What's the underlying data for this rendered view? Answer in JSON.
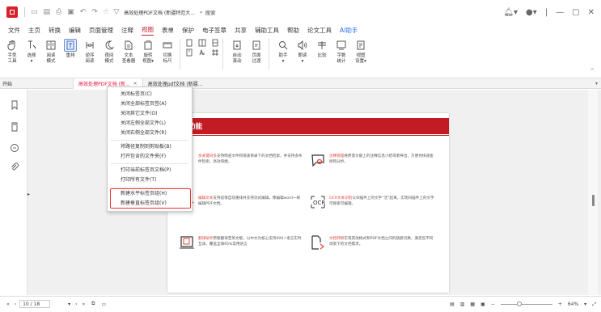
{
  "titlebar": {
    "doc_title": "高效处理PDF文档 (新疆特范大...",
    "search_label": "搜索"
  },
  "menu": [
    "文件",
    "主页",
    "转换",
    "编辑",
    "页面管理",
    "注释",
    "视图",
    "表单",
    "保护",
    "电子签章",
    "共享",
    "辅助工具",
    "帮助",
    "论文工具",
    "AI助手"
  ],
  "menu_active": "视图",
  "toolbar": [
    {
      "label": "手型\n工具",
      "icon": "hand-icon"
    },
    {
      "label": "选择\n▾",
      "icon": "select-cursor-icon"
    },
    {
      "label": "阅读\n模式",
      "icon": "read-mode-icon"
    },
    {
      "label": "重排",
      "icon": "reflow-icon"
    },
    {
      "label": "逆序\n阅读",
      "icon": "reverse-read-icon"
    },
    {
      "label": "夜间\n模式",
      "icon": "night-mode-icon"
    },
    {
      "label": "文本\n查看器",
      "icon": "text-viewer-icon"
    },
    {
      "label": "旋转\n视图▾",
      "icon": "rotate-view-icon"
    },
    {
      "label": "切换\n标尺",
      "icon": "ruler-icon"
    },
    {
      "label": "自动\n滚动",
      "icon": "auto-scroll-icon"
    },
    {
      "label": "页面\n过渡",
      "icon": "page-transition-icon"
    },
    {
      "label": "助手\n▾",
      "icon": "assistant-icon"
    },
    {
      "label": "朗读\n▾",
      "icon": "read-aloud-icon"
    },
    {
      "label": "比较",
      "icon": "compare-icon"
    },
    {
      "label": "字数\n统计",
      "icon": "word-count-icon"
    },
    {
      "label": "视图\n设置▾",
      "icon": "view-settings-icon"
    }
  ],
  "tabs": {
    "start": "开始",
    "current": "高效处理PDF文档 (新...",
    "other": "高效处理pdf文档 (新疆..."
  },
  "page": {
    "banner": "功能",
    "features": [
      {
        "hl": "多关键词多",
        "text": "支持倒查文件和快速目录下的文档检索，并支持多条件检索，高效快捷。"
      },
      {
        "hl": "注释管理",
        "text": "将原意文献上的注释信息小结或者导出，方便你快速查阅和分析。"
      },
      {
        "hl": "编辑文本",
        "text": "支持段落自动重排并支持流式编辑，像编辑word一样编辑PDF文档。"
      },
      {
        "hl": "OCR文本识别",
        "text": "以扫描件上的文字“活”起来，实现扫描件上的文字可搜索可编辑。"
      },
      {
        "hl": "翻译助手",
        "text": "原版翻译至英文版，以中文为核心支持400+语言实时互译，覆盖全球95%常用语言"
      },
      {
        "hl": "文档转换",
        "text": "实现其他格式和PDF文档之间的随意切换，满足您不同场景下的文档需求。"
      }
    ]
  },
  "context_menu": [
    "关闭标签页(C)",
    "关闭全部标签页签(A)",
    "关闭其它文件(O)",
    "关闭左侧全部文件(L)",
    "关闭右侧全部文件(R)",
    "将路径复制到剪贴板(B)",
    "打开包含的文件夹(F)",
    "打印当前标签页文档(P)",
    "打印所有文件(T)",
    "新建水平标签页组(H)",
    "新建垂直标签页组(V)"
  ],
  "status": {
    "page_value": "10 / 18",
    "zoom": "64%"
  },
  "colors": {
    "accent": "#c81e2b",
    "banner": "#c31b23",
    "ai": "#2f6ff0"
  }
}
